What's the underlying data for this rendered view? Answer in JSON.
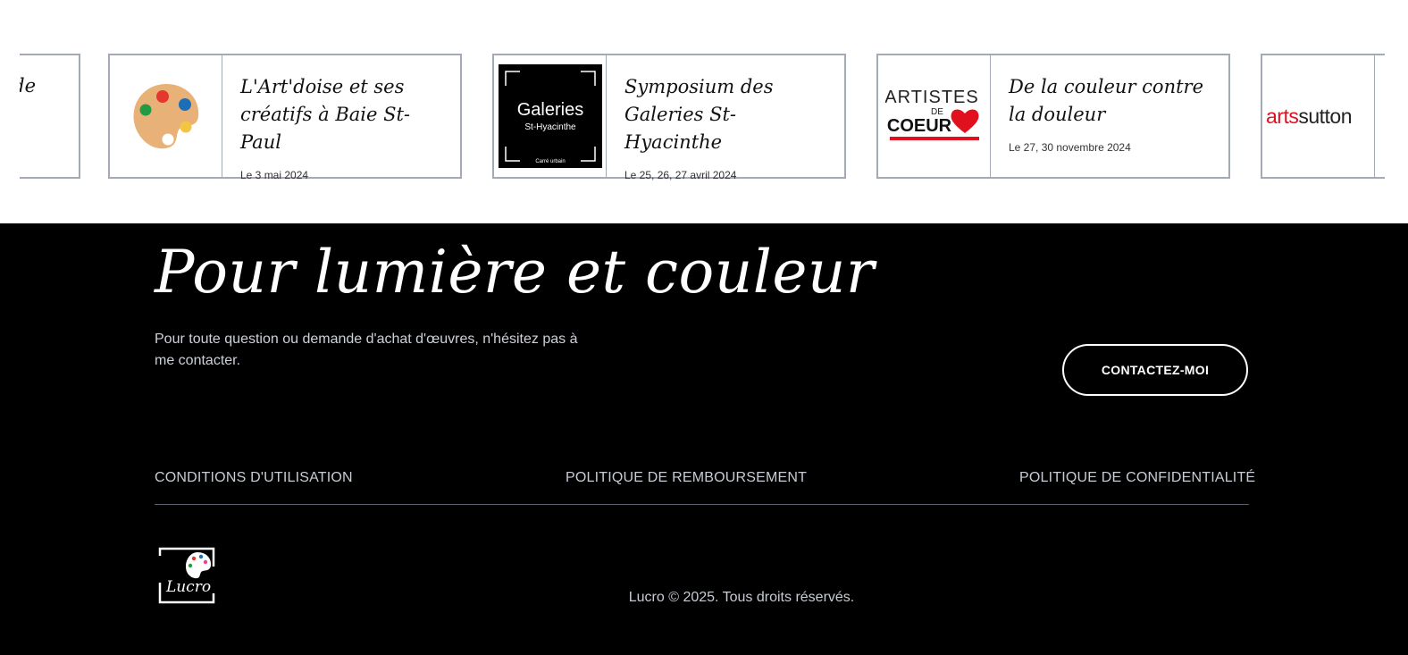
{
  "carousel": {
    "partial_left_title": "de",
    "cards": [
      {
        "title": "L'Art'doise et ses créatifs à Baie St-Paul",
        "date": "Le 3 mai 2024",
        "thumb_icon": "palette-icon"
      },
      {
        "title": "Symposium des Galeries St-Hyacinthe",
        "date": "Le 25, 26, 27 avril 2024",
        "thumb_logo": {
          "line1": "Galeries",
          "line2": "St-Hyacinthe",
          "line3": "Carré urbain"
        }
      },
      {
        "title": "De la couleur contre la douleur",
        "date": "Le 27, 30 novembre 2024",
        "thumb_logo": {
          "line1": "ARTISTES",
          "line2": "DE",
          "line3": "COEUR"
        }
      },
      {
        "title": "",
        "date": "",
        "thumb_logo": {
          "part1": "arts",
          "part2": "sutton"
        }
      }
    ]
  },
  "footer": {
    "headline": "Pour lumière et couleur",
    "lead": "Pour toute question ou demande d'achat d'œuvres, n'hésitez pas à me contacter.",
    "contact_button": "CONTACTEZ-MOI",
    "links": [
      "CONDITIONS D'UTILISATION",
      "POLITIQUE DE REMBOURSEMENT",
      "POLITIQUE DE CONFIDENTIALITÉ"
    ],
    "logo_text": "Lucro",
    "copyright": "Lucro © 2025. Tous droits réservés."
  },
  "colors": {
    "card_border": "#a3aab5",
    "footer_bg": "#000000",
    "accent_red": "#e0101e",
    "muted_text": "#c7ccd4"
  }
}
